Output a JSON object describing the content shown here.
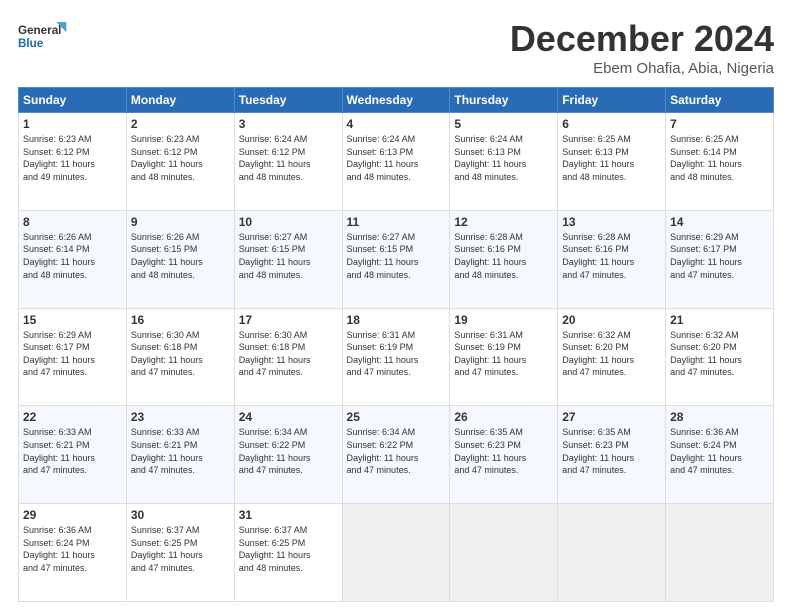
{
  "logo": {
    "line1": "General",
    "line2": "Blue"
  },
  "title": "December 2024",
  "location": "Ebem Ohafia, Abia, Nigeria",
  "header_days": [
    "Sunday",
    "Monday",
    "Tuesday",
    "Wednesday",
    "Thursday",
    "Friday",
    "Saturday"
  ],
  "weeks": [
    [
      {
        "day": "1",
        "info": "Sunrise: 6:23 AM\nSunset: 6:12 PM\nDaylight: 11 hours\nand 49 minutes."
      },
      {
        "day": "2",
        "info": "Sunrise: 6:23 AM\nSunset: 6:12 PM\nDaylight: 11 hours\nand 48 minutes."
      },
      {
        "day": "3",
        "info": "Sunrise: 6:24 AM\nSunset: 6:12 PM\nDaylight: 11 hours\nand 48 minutes."
      },
      {
        "day": "4",
        "info": "Sunrise: 6:24 AM\nSunset: 6:13 PM\nDaylight: 11 hours\nand 48 minutes."
      },
      {
        "day": "5",
        "info": "Sunrise: 6:24 AM\nSunset: 6:13 PM\nDaylight: 11 hours\nand 48 minutes."
      },
      {
        "day": "6",
        "info": "Sunrise: 6:25 AM\nSunset: 6:13 PM\nDaylight: 11 hours\nand 48 minutes."
      },
      {
        "day": "7",
        "info": "Sunrise: 6:25 AM\nSunset: 6:14 PM\nDaylight: 11 hours\nand 48 minutes."
      }
    ],
    [
      {
        "day": "8",
        "info": "Sunrise: 6:26 AM\nSunset: 6:14 PM\nDaylight: 11 hours\nand 48 minutes."
      },
      {
        "day": "9",
        "info": "Sunrise: 6:26 AM\nSunset: 6:15 PM\nDaylight: 11 hours\nand 48 minutes."
      },
      {
        "day": "10",
        "info": "Sunrise: 6:27 AM\nSunset: 6:15 PM\nDaylight: 11 hours\nand 48 minutes."
      },
      {
        "day": "11",
        "info": "Sunrise: 6:27 AM\nSunset: 6:15 PM\nDaylight: 11 hours\nand 48 minutes."
      },
      {
        "day": "12",
        "info": "Sunrise: 6:28 AM\nSunset: 6:16 PM\nDaylight: 11 hours\nand 48 minutes."
      },
      {
        "day": "13",
        "info": "Sunrise: 6:28 AM\nSunset: 6:16 PM\nDaylight: 11 hours\nand 47 minutes."
      },
      {
        "day": "14",
        "info": "Sunrise: 6:29 AM\nSunset: 6:17 PM\nDaylight: 11 hours\nand 47 minutes."
      }
    ],
    [
      {
        "day": "15",
        "info": "Sunrise: 6:29 AM\nSunset: 6:17 PM\nDaylight: 11 hours\nand 47 minutes."
      },
      {
        "day": "16",
        "info": "Sunrise: 6:30 AM\nSunset: 6:18 PM\nDaylight: 11 hours\nand 47 minutes."
      },
      {
        "day": "17",
        "info": "Sunrise: 6:30 AM\nSunset: 6:18 PM\nDaylight: 11 hours\nand 47 minutes."
      },
      {
        "day": "18",
        "info": "Sunrise: 6:31 AM\nSunset: 6:19 PM\nDaylight: 11 hours\nand 47 minutes."
      },
      {
        "day": "19",
        "info": "Sunrise: 6:31 AM\nSunset: 6:19 PM\nDaylight: 11 hours\nand 47 minutes."
      },
      {
        "day": "20",
        "info": "Sunrise: 6:32 AM\nSunset: 6:20 PM\nDaylight: 11 hours\nand 47 minutes."
      },
      {
        "day": "21",
        "info": "Sunrise: 6:32 AM\nSunset: 6:20 PM\nDaylight: 11 hours\nand 47 minutes."
      }
    ],
    [
      {
        "day": "22",
        "info": "Sunrise: 6:33 AM\nSunset: 6:21 PM\nDaylight: 11 hours\nand 47 minutes."
      },
      {
        "day": "23",
        "info": "Sunrise: 6:33 AM\nSunset: 6:21 PM\nDaylight: 11 hours\nand 47 minutes."
      },
      {
        "day": "24",
        "info": "Sunrise: 6:34 AM\nSunset: 6:22 PM\nDaylight: 11 hours\nand 47 minutes."
      },
      {
        "day": "25",
        "info": "Sunrise: 6:34 AM\nSunset: 6:22 PM\nDaylight: 11 hours\nand 47 minutes."
      },
      {
        "day": "26",
        "info": "Sunrise: 6:35 AM\nSunset: 6:23 PM\nDaylight: 11 hours\nand 47 minutes."
      },
      {
        "day": "27",
        "info": "Sunrise: 6:35 AM\nSunset: 6:23 PM\nDaylight: 11 hours\nand 47 minutes."
      },
      {
        "day": "28",
        "info": "Sunrise: 6:36 AM\nSunset: 6:24 PM\nDaylight: 11 hours\nand 47 minutes."
      }
    ],
    [
      {
        "day": "29",
        "info": "Sunrise: 6:36 AM\nSunset: 6:24 PM\nDaylight: 11 hours\nand 47 minutes."
      },
      {
        "day": "30",
        "info": "Sunrise: 6:37 AM\nSunset: 6:25 PM\nDaylight: 11 hours\nand 47 minutes."
      },
      {
        "day": "31",
        "info": "Sunrise: 6:37 AM\nSunset: 6:25 PM\nDaylight: 11 hours\nand 48 minutes."
      },
      null,
      null,
      null,
      null
    ]
  ]
}
